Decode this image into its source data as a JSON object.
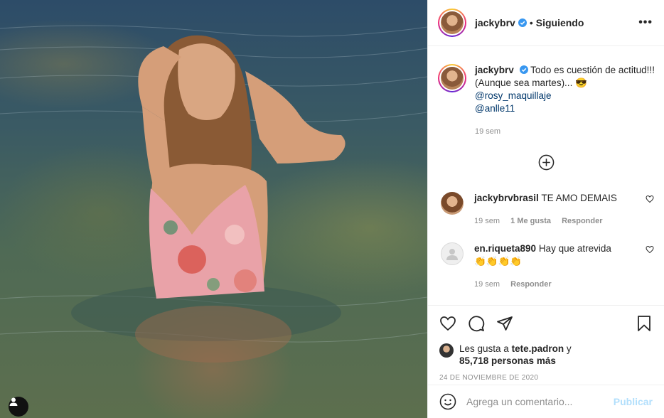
{
  "post": {
    "author": "jackybrv",
    "follow_status": "Siguiendo",
    "separator": "•",
    "more_icon": "•••"
  },
  "caption": {
    "author": "jackybrv",
    "text": "Todo es cuestión de actitud!!! (Aunque sea martes)... 😎",
    "mention_1": "@rosy_maquillaje",
    "mention_2": "@anlle11",
    "time": "19 sem"
  },
  "comments": [
    {
      "author": "jackybrvbrasil",
      "text": "TE AMO DEMAIS",
      "time": "19 sem",
      "likes": "1 Me gusta",
      "reply": "Responder"
    },
    {
      "author": "en.riqueta890",
      "text": "Hay que atrevida",
      "emoji": "👏👏👏👏",
      "time": "19 sem",
      "reply": "Responder"
    }
  ],
  "likes": {
    "prefix": "Les gusta a",
    "user": "tete.padron",
    "suffix": "y",
    "count": "85,718 personas más"
  },
  "date": "24 DE NOVIEMBRE DE 2020",
  "add_comment": {
    "placeholder": "Agrega un comentario...",
    "publish": "Publicar"
  },
  "colors": {
    "verified": "#3897f0",
    "link": "#00376b",
    "publish_disabled": "#b2dffc"
  }
}
